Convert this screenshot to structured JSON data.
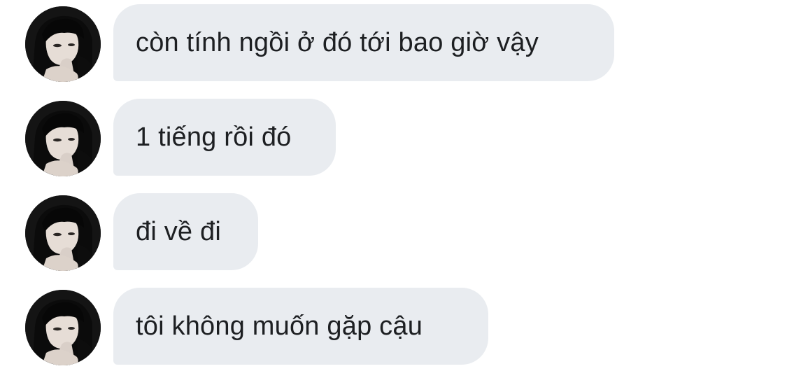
{
  "messages": [
    {
      "text": "còn tính ngồi ở đó tới bao giờ vậy"
    },
    {
      "text": "1 tiếng rồi đó"
    },
    {
      "text": "đi về đi"
    },
    {
      "text": "tôi không muốn gặp cậu"
    }
  ],
  "colors": {
    "bubble": "#e9ecf0",
    "text": "#1d1f22",
    "background": "#ffffff"
  },
  "icons": {
    "avatar": "avatar-photo"
  }
}
